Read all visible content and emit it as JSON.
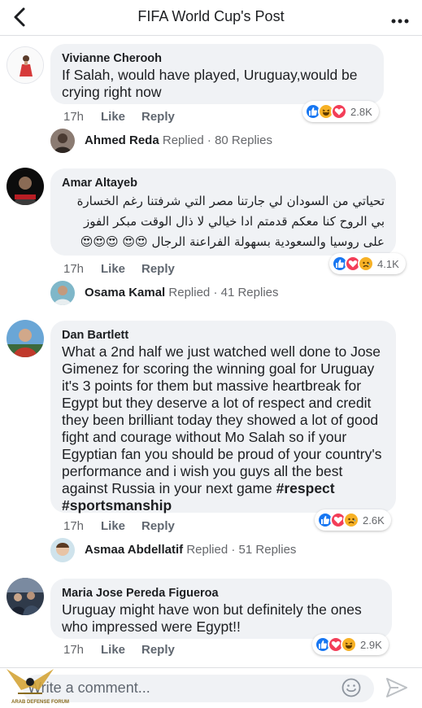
{
  "header": {
    "title": "FIFA World Cup's Post"
  },
  "comments": [
    {
      "author": "Vivianne Cherooh",
      "text": "If Salah, would have played, Uruguay,would be crying right now",
      "time": "17h",
      "like_label": "Like",
      "reply_label": "Reply",
      "reaction_count": "2.8K",
      "reactions": [
        "like",
        "haha",
        "love"
      ]
    },
    {
      "author": "Amar Altayeb",
      "text_lines": [
        "تحياتي من السودان لي جارتنا مصر التي شرفتنا رغم الخسارة",
        "بي الروح كنا معكم قدمتم ادا خيالي لا ذال الوقت مبكر الفوز",
        "على روسيا والسعودية بسهولة الفراعنة الرجال 😍😍 😍😍😍"
      ],
      "time": "17h",
      "like_label": "Like",
      "reply_label": "Reply",
      "reaction_count": "4.1K",
      "reactions": [
        "like",
        "love",
        "sad"
      ]
    },
    {
      "author": "Dan Bartlett",
      "text": "What a 2nd half we just watched well done to Jose Gimenez for scoring the winning goal for Uruguay it's 3 points for them but massive heartbreak for Egypt but they deserve a lot of respect and credit they been brilliant today they showed a lot of good fight and courage without Mo Salah so if your Egyptian fan you should be proud of your country's performance and i wish you guys all the best against Russia in your next game",
      "hashtags": "#respect #sportsmanship",
      "time": "17h",
      "like_label": "Like",
      "reply_label": "Reply",
      "reaction_count": "2.6K",
      "reactions": [
        "like",
        "love",
        "sad"
      ]
    },
    {
      "author": "Maria Jose Pereda Figueroa",
      "text": "Uruguay might have won but definitely the ones who impressed were Egypt!!",
      "time": "17h",
      "like_label": "Like",
      "reply_label": "Reply",
      "reaction_count": "2.9K",
      "reactions": [
        "like",
        "love",
        "haha"
      ]
    }
  ],
  "replies": [
    {
      "name": "Ahmed Reda",
      "replied": "Replied",
      "count": "· 80 Replies"
    },
    {
      "name": "Osama Kamal",
      "replied": "Replied",
      "count": "· 41 Replies"
    },
    {
      "name": "Asmaa Abdellatif",
      "replied": "Replied",
      "count": "· 51 Replies"
    }
  ],
  "composer": {
    "placeholder": "Write a comment..."
  },
  "watermark": {
    "text": "ARAB DEFENSE FORUM"
  },
  "colors": {
    "like_blue": "#1877f2",
    "love_red": "#f33e58",
    "haha_yellow": "#f7b125",
    "bubble_bg": "#f0f2f5"
  },
  "icons": {
    "back": "chevron-left-icon",
    "more": "more-dots-icon",
    "emoji": "smiley-icon",
    "send": "send-icon"
  }
}
